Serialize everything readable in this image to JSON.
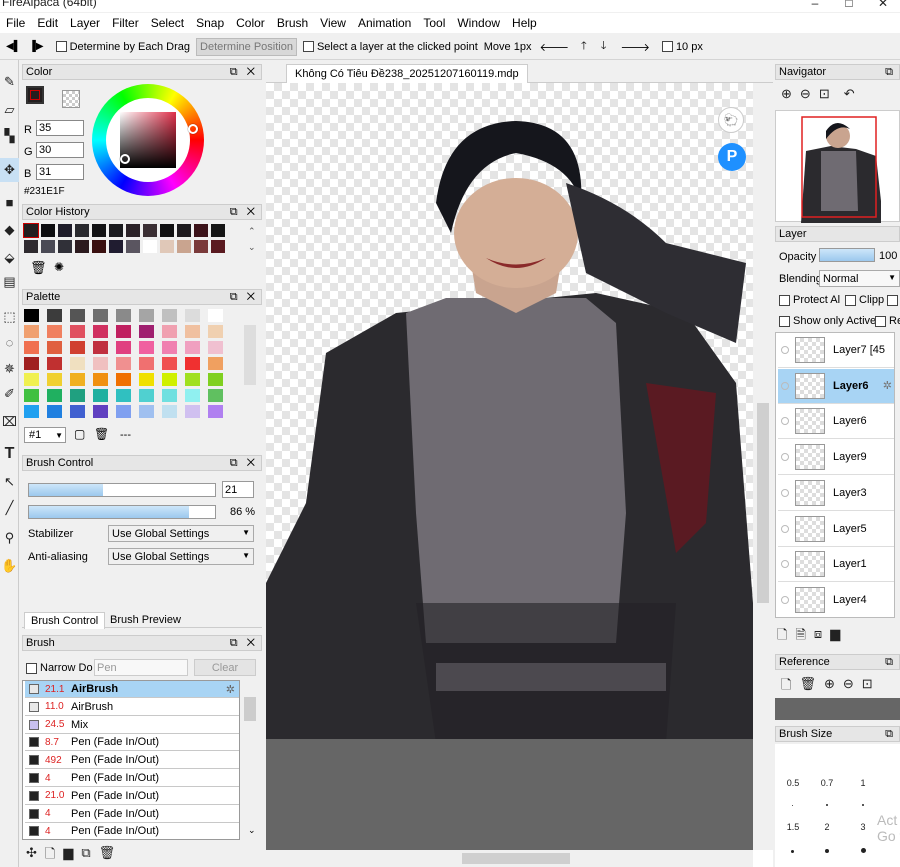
{
  "window": {
    "title": "FireAlpaca (64bit)",
    "controls": [
      "–",
      "□",
      "✕"
    ]
  },
  "menu": [
    "File",
    "Edit",
    "Layer",
    "Filter",
    "Select",
    "Snap",
    "Color",
    "Brush",
    "View",
    "Animation",
    "Tool",
    "Window",
    "Help"
  ],
  "toolbar": {
    "determine_each_drag": "Determine by Each Drag",
    "determine_position": "Determine Position",
    "select_layer": "Select a layer at the clicked point",
    "move": "Move 1px",
    "grid": "10 px"
  },
  "color_panel": {
    "title": "Color",
    "r_label": "R",
    "r": "35",
    "g_label": "G",
    "g": "30",
    "b_label": "B",
    "b": "31",
    "hex": "#231E1F",
    "current": "#231E1F"
  },
  "color_history": {
    "title": "Color History",
    "colors": [
      "#231e1f",
      "#0d0d10",
      "#1f1d2a",
      "#2a2a2f",
      "#121214",
      "#1a1a1e",
      "#2b2228",
      "#3a2e33",
      "#101012",
      "#1e1b1f",
      "#3b1219",
      "#161616",
      "#2e2a2f",
      "#4a4a55",
      "#303038",
      "#2b1a1e",
      "#3a1010",
      "#201c30",
      "#5a5560",
      "#ffffff",
      "#e0c8b8",
      "#c9a48f",
      "#7a3a3a",
      "#5a1a20"
    ]
  },
  "palette": {
    "title": "Palette",
    "selector": "#1",
    "more": "---",
    "colors": [
      "#000000",
      "#3c3c3c",
      "#555555",
      "#6e6e6e",
      "#8a8a8a",
      "#a5a5a5",
      "#c0c0c0",
      "#dcdcdc",
      "#ffffff",
      "#f0a070",
      "#f08060",
      "#e05060",
      "#d03060",
      "#c02060",
      "#a02070",
      "#f0a0b0",
      "#f0c0a0",
      "#f0d0b0",
      "#f07050",
      "#e06040",
      "#d04030",
      "#c03040",
      "#e04080",
      "#f060a0",
      "#f080b0",
      "#f0a0c0",
      "#f0c0d0",
      "#a02020",
      "#c03030",
      "#f0e0c0",
      "#f0c0c0",
      "#f09090",
      "#f07070",
      "#f05050",
      "#f03030",
      "#f0a060",
      "#f0f050",
      "#f0d030",
      "#f0b020",
      "#f09010",
      "#f07000",
      "#f0e000",
      "#d0f000",
      "#a0e020",
      "#80d020",
      "#40c040",
      "#20b060",
      "#20a080",
      "#20b0a0",
      "#30c0c0",
      "#50d0d0",
      "#70e0e0",
      "#90f0f0",
      "#60c060",
      "#20a0f0",
      "#2080e0",
      "#4060d0",
      "#6040c0",
      "#80a0f0",
      "#a0c0f0",
      "#c0e0f0",
      "#d0c0f0",
      "#b080f0"
    ]
  },
  "brush_control": {
    "title": "Brush Control",
    "size": "21",
    "opacity": "86 %",
    "size_fill": 0.4,
    "opacity_fill": 0.86,
    "stabilizer_label": "Stabilizer",
    "stabilizer": "Use Global Settings",
    "aa_label": "Anti-aliasing",
    "aa": "Use Global Settings",
    "tabs": [
      "Brush Control",
      "Brush Preview"
    ]
  },
  "brush": {
    "title": "Brush",
    "narrow": "Narrow Do",
    "search": "Pen",
    "clear": "Clear",
    "items": [
      {
        "size": "21.1",
        "name": "AirBrush",
        "color": "#e8e8e8",
        "selected": true
      },
      {
        "size": "11.0",
        "name": "AirBrush",
        "color": "#e8e8e8"
      },
      {
        "size": "24.5",
        "name": "Mix",
        "color": "#c8c0f0"
      },
      {
        "size": "8.7",
        "name": "Pen (Fade In/Out)",
        "color": "#222222"
      },
      {
        "size": "492",
        "name": "Pen (Fade In/Out)",
        "color": "#222222"
      },
      {
        "size": "4",
        "name": "Pen (Fade In/Out)",
        "color": "#222222"
      },
      {
        "size": "21.0",
        "name": "Pen (Fade In/Out)",
        "color": "#222222"
      },
      {
        "size": "4",
        "name": "Pen (Fade In/Out)",
        "color": "#222222"
      },
      {
        "size": "4",
        "name": "Pen (Fade In/Out)",
        "color": "#222222"
      }
    ]
  },
  "document": {
    "tab": "Không Có Tiêu Đề238_20251207160119.mdp"
  },
  "navigator": {
    "title": "Navigator"
  },
  "layer_panel": {
    "title": "Layer",
    "opacity_label": "Opacity",
    "opacity": "100 %",
    "opacity_fill": 1.0,
    "blending_label": "Blending",
    "blending": "Normal",
    "protect": "Protect Al",
    "clip": "Clipp",
    "show_active": "Show only Active",
    "ref": "Re",
    "layers": [
      {
        "name": "Layer7 [45",
        "selected": false
      },
      {
        "name": "Layer6",
        "selected": true
      },
      {
        "name": "Layer6",
        "selected": false
      },
      {
        "name": "Layer9",
        "selected": false
      },
      {
        "name": "Layer3",
        "selected": false
      },
      {
        "name": "Layer5",
        "selected": false
      },
      {
        "name": "Layer1",
        "selected": false
      },
      {
        "name": "Layer4",
        "selected": false
      }
    ]
  },
  "reference": {
    "title": "Reference"
  },
  "brush_size": {
    "title": "Brush Size",
    "sizes": [
      "0.5",
      "0.7",
      "1",
      "1.5",
      "2",
      "3"
    ]
  },
  "watermark": "Act\nGo t"
}
